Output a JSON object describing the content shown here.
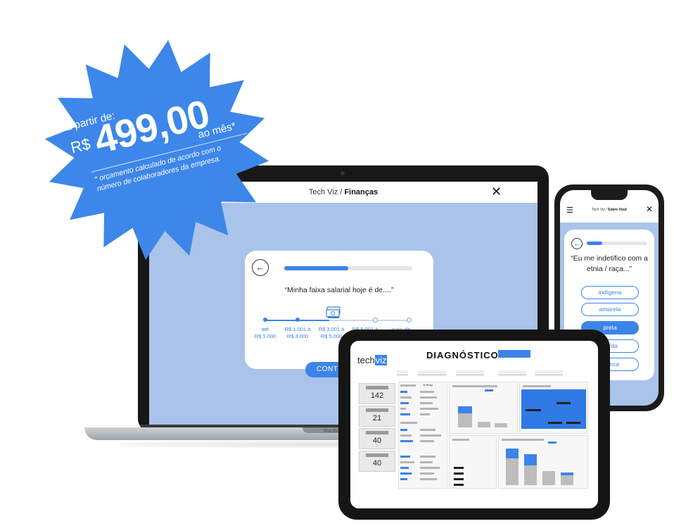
{
  "colors": {
    "accent": "#3c84e8",
    "screen_bg": "#aac3ea",
    "device": "#171717",
    "burst": "#3d86ea"
  },
  "promo": {
    "prefix": "a partir de:",
    "currency": "R$",
    "price": "499,00",
    "period": "ao mês*",
    "footnote_line1": "* orçamento calculado de acordo com o",
    "footnote_line2": "número de colaboradores da empresa."
  },
  "laptop": {
    "title_prefix": "Tech Viz /",
    "title_section": "Finanças",
    "close_icon": "close-icon",
    "back_icon": "arrow-left-icon",
    "progress_percent": 50,
    "question": "“Minha faixa salarial hoje é de....”",
    "slider_icon": "money-stack-icon",
    "ranges": [
      {
        "line1": "até",
        "line2": "R$ 1.000"
      },
      {
        "line1": "R$ 1.001 à",
        "line2": "R$ 3.000"
      },
      {
        "line1": "R$ 3.001 à",
        "line2": "R$ 5.000"
      },
      {
        "line1": "R$ 5.001 à",
        "line2": ""
      },
      {
        "line1": "mais de",
        "line2": ""
      }
    ],
    "continue_label": "CONTINUAR",
    "brand": "MacBook"
  },
  "phone": {
    "menu_icon": "hamburger-menu-icon",
    "title_prefix": "Tech Viz /",
    "title_section": "Sobre Você",
    "close_icon": "close-icon",
    "back_icon": "arrow-left-icon",
    "progress_percent": 25,
    "question": "“Eu me indetifico com a etnia / raça...”",
    "options": [
      {
        "label": "indígena",
        "selected": false
      },
      {
        "label": "amarela",
        "selected": false
      },
      {
        "label": "preta",
        "selected": true
      },
      {
        "label": "parda",
        "selected": false
      },
      {
        "label": "branca",
        "selected": false
      }
    ]
  },
  "tablet": {
    "logo_tech": "tech",
    "logo_viz": "viz",
    "title": "DIAGNÓSTICO",
    "kpis": [
      "142",
      "21",
      "40",
      "40"
    ],
    "table_header": "% Resp"
  }
}
